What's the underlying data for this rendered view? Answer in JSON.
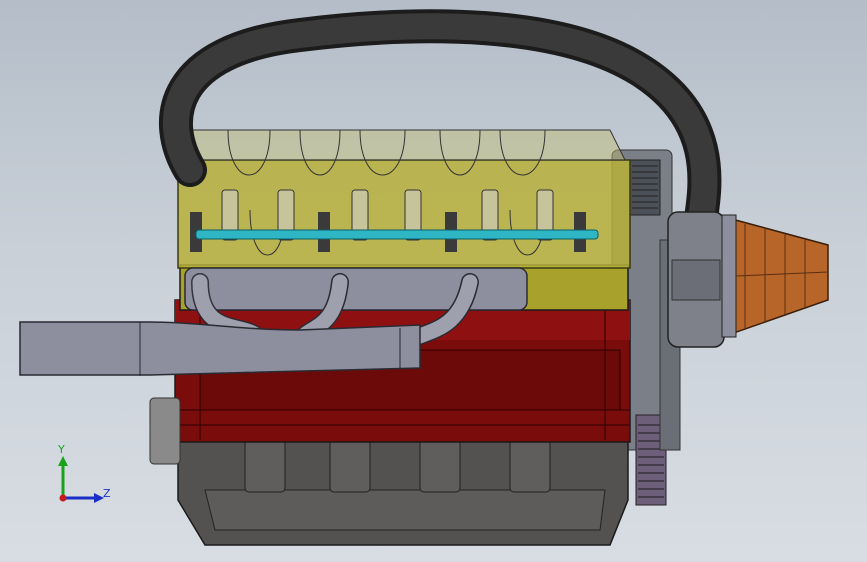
{
  "viewport": {
    "background_top": "#b4bdc8",
    "background_bottom": "#d8dde3"
  },
  "model": {
    "colors": {
      "hose": "#2a2a2a",
      "valve_cover": "#b7b03a",
      "head": "#a8a22c",
      "block": "#7a0c0c",
      "block_light": "#a81818",
      "oil_pan": "#545250",
      "exhaust": "#8d8f9e",
      "fuel_rail": "#2fb6c4",
      "air_filter": "#b8652a",
      "pulley": "#5d5d66"
    },
    "icons": [
      "radiator-hose-icon",
      "exhaust-manifold-icon",
      "air-filter-icon",
      "timing-pulley-icon"
    ]
  },
  "triad": {
    "y_label": "Y",
    "z_label": "Z",
    "y_color": "#1aa31a",
    "z_color": "#1a2fc8",
    "x_color": "#c81a1a"
  }
}
